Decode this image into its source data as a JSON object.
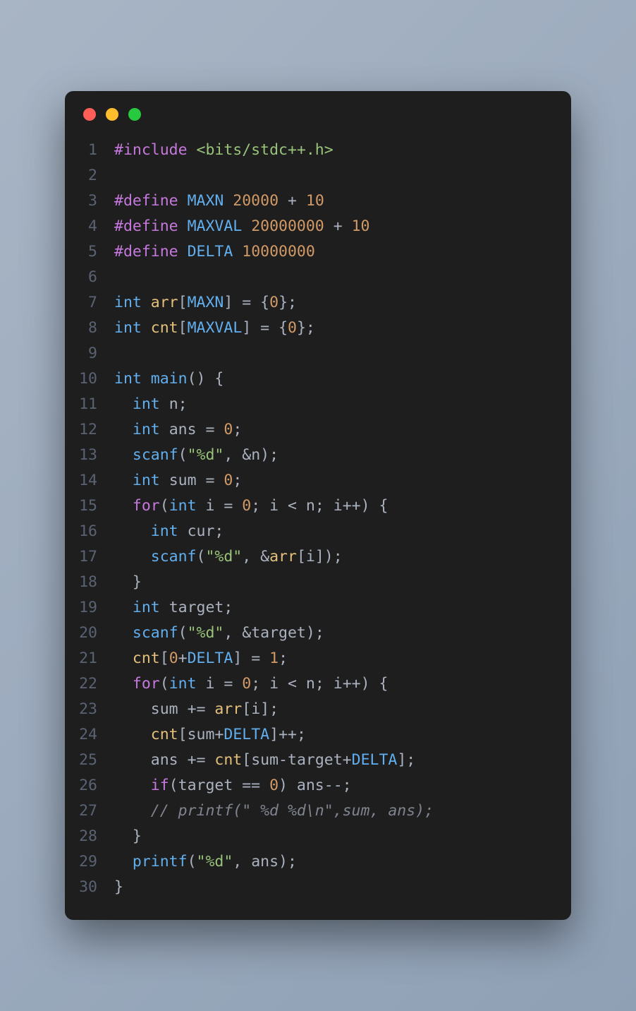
{
  "window": {
    "buttons": [
      "close",
      "minimize",
      "maximize"
    ]
  },
  "code": {
    "lines": [
      {
        "n": "1",
        "tokens": [
          [
            "directive",
            "#include"
          ],
          [
            "op",
            " "
          ],
          [
            "string",
            "<bits/stdc++.h>"
          ]
        ]
      },
      {
        "n": "2",
        "tokens": []
      },
      {
        "n": "3",
        "tokens": [
          [
            "directive",
            "#define"
          ],
          [
            "op",
            " "
          ],
          [
            "macro-name",
            "MAXN"
          ],
          [
            "op",
            " "
          ],
          [
            "number",
            "20000"
          ],
          [
            "op",
            " + "
          ],
          [
            "number",
            "10"
          ]
        ]
      },
      {
        "n": "4",
        "tokens": [
          [
            "directive",
            "#define"
          ],
          [
            "op",
            " "
          ],
          [
            "macro-name",
            "MAXVAL"
          ],
          [
            "op",
            " "
          ],
          [
            "number",
            "20000000"
          ],
          [
            "op",
            " + "
          ],
          [
            "number",
            "10"
          ]
        ]
      },
      {
        "n": "5",
        "tokens": [
          [
            "directive",
            "#define"
          ],
          [
            "op",
            " "
          ],
          [
            "macro-name",
            "DELTA"
          ],
          [
            "op",
            " "
          ],
          [
            "number",
            "10000000"
          ]
        ]
      },
      {
        "n": "6",
        "tokens": []
      },
      {
        "n": "7",
        "tokens": [
          [
            "type",
            "int"
          ],
          [
            "op",
            " "
          ],
          [
            "ident",
            "arr"
          ],
          [
            "punct",
            "["
          ],
          [
            "macro-name",
            "MAXN"
          ],
          [
            "punct",
            "]"
          ],
          [
            "op",
            " = "
          ],
          [
            "punct",
            "{"
          ],
          [
            "number",
            "0"
          ],
          [
            "punct",
            "};"
          ]
        ]
      },
      {
        "n": "8",
        "tokens": [
          [
            "type",
            "int"
          ],
          [
            "op",
            " "
          ],
          [
            "ident",
            "cnt"
          ],
          [
            "punct",
            "["
          ],
          [
            "macro-name",
            "MAXVAL"
          ],
          [
            "punct",
            "]"
          ],
          [
            "op",
            " = "
          ],
          [
            "punct",
            "{"
          ],
          [
            "number",
            "0"
          ],
          [
            "punct",
            "};"
          ]
        ]
      },
      {
        "n": "9",
        "tokens": []
      },
      {
        "n": "10",
        "tokens": [
          [
            "type",
            "int"
          ],
          [
            "op",
            " "
          ],
          [
            "func",
            "main"
          ],
          [
            "punct",
            "()"
          ],
          [
            "op",
            " "
          ],
          [
            "punct",
            "{"
          ]
        ]
      },
      {
        "n": "11",
        "tokens": [
          [
            "op",
            "  "
          ],
          [
            "type",
            "int"
          ],
          [
            "op",
            " "
          ],
          [
            "var",
            "n"
          ],
          [
            "punct",
            ";"
          ]
        ]
      },
      {
        "n": "12",
        "tokens": [
          [
            "op",
            "  "
          ],
          [
            "type",
            "int"
          ],
          [
            "op",
            " "
          ],
          [
            "var",
            "ans"
          ],
          [
            "op",
            " = "
          ],
          [
            "number",
            "0"
          ],
          [
            "punct",
            ";"
          ]
        ]
      },
      {
        "n": "13",
        "tokens": [
          [
            "op",
            "  "
          ],
          [
            "func",
            "scanf"
          ],
          [
            "punct",
            "("
          ],
          [
            "string",
            "\"%d\""
          ],
          [
            "punct",
            ", "
          ],
          [
            "op",
            "&"
          ],
          [
            "var",
            "n"
          ],
          [
            "punct",
            ");"
          ]
        ]
      },
      {
        "n": "14",
        "tokens": [
          [
            "op",
            "  "
          ],
          [
            "type",
            "int"
          ],
          [
            "op",
            " "
          ],
          [
            "var",
            "sum"
          ],
          [
            "op",
            " = "
          ],
          [
            "number",
            "0"
          ],
          [
            "punct",
            ";"
          ]
        ]
      },
      {
        "n": "15",
        "tokens": [
          [
            "op",
            "  "
          ],
          [
            "keyword",
            "for"
          ],
          [
            "punct",
            "("
          ],
          [
            "type",
            "int"
          ],
          [
            "op",
            " "
          ],
          [
            "var",
            "i"
          ],
          [
            "op",
            " = "
          ],
          [
            "number",
            "0"
          ],
          [
            "punct",
            "; "
          ],
          [
            "var",
            "i"
          ],
          [
            "op",
            " < "
          ],
          [
            "var",
            "n"
          ],
          [
            "punct",
            "; "
          ],
          [
            "var",
            "i"
          ],
          [
            "op",
            "++"
          ],
          [
            "punct",
            ") {"
          ]
        ]
      },
      {
        "n": "16",
        "tokens": [
          [
            "op",
            "    "
          ],
          [
            "type",
            "int"
          ],
          [
            "op",
            " "
          ],
          [
            "var",
            "cur"
          ],
          [
            "punct",
            ";"
          ]
        ]
      },
      {
        "n": "17",
        "tokens": [
          [
            "op",
            "    "
          ],
          [
            "func",
            "scanf"
          ],
          [
            "punct",
            "("
          ],
          [
            "string",
            "\"%d\""
          ],
          [
            "punct",
            ", "
          ],
          [
            "op",
            "&"
          ],
          [
            "ident",
            "arr"
          ],
          [
            "punct",
            "["
          ],
          [
            "var",
            "i"
          ],
          [
            "punct",
            "]);"
          ]
        ]
      },
      {
        "n": "18",
        "tokens": [
          [
            "op",
            "  "
          ],
          [
            "punct",
            "}"
          ]
        ]
      },
      {
        "n": "19",
        "tokens": [
          [
            "op",
            "  "
          ],
          [
            "type",
            "int"
          ],
          [
            "op",
            " "
          ],
          [
            "var",
            "target"
          ],
          [
            "punct",
            ";"
          ]
        ]
      },
      {
        "n": "20",
        "tokens": [
          [
            "op",
            "  "
          ],
          [
            "func",
            "scanf"
          ],
          [
            "punct",
            "("
          ],
          [
            "string",
            "\"%d\""
          ],
          [
            "punct",
            ", "
          ],
          [
            "op",
            "&"
          ],
          [
            "var",
            "target"
          ],
          [
            "punct",
            ");"
          ]
        ]
      },
      {
        "n": "21",
        "tokens": [
          [
            "op",
            "  "
          ],
          [
            "ident",
            "cnt"
          ],
          [
            "punct",
            "["
          ],
          [
            "number",
            "0"
          ],
          [
            "op",
            "+"
          ],
          [
            "macro-name",
            "DELTA"
          ],
          [
            "punct",
            "]"
          ],
          [
            "op",
            " = "
          ],
          [
            "number",
            "1"
          ],
          [
            "punct",
            ";"
          ]
        ]
      },
      {
        "n": "22",
        "tokens": [
          [
            "op",
            "  "
          ],
          [
            "keyword",
            "for"
          ],
          [
            "punct",
            "("
          ],
          [
            "type",
            "int"
          ],
          [
            "op",
            " "
          ],
          [
            "var",
            "i"
          ],
          [
            "op",
            " = "
          ],
          [
            "number",
            "0"
          ],
          [
            "punct",
            "; "
          ],
          [
            "var",
            "i"
          ],
          [
            "op",
            " < "
          ],
          [
            "var",
            "n"
          ],
          [
            "punct",
            "; "
          ],
          [
            "var",
            "i"
          ],
          [
            "op",
            "++"
          ],
          [
            "punct",
            ") {"
          ]
        ]
      },
      {
        "n": "23",
        "tokens": [
          [
            "op",
            "    "
          ],
          [
            "var",
            "sum"
          ],
          [
            "op",
            " += "
          ],
          [
            "ident",
            "arr"
          ],
          [
            "punct",
            "["
          ],
          [
            "var",
            "i"
          ],
          [
            "punct",
            "];"
          ]
        ]
      },
      {
        "n": "24",
        "tokens": [
          [
            "op",
            "    "
          ],
          [
            "ident",
            "cnt"
          ],
          [
            "punct",
            "["
          ],
          [
            "var",
            "sum"
          ],
          [
            "op",
            "+"
          ],
          [
            "macro-name",
            "DELTA"
          ],
          [
            "punct",
            "]"
          ],
          [
            "op",
            "++"
          ],
          [
            "punct",
            ";"
          ]
        ]
      },
      {
        "n": "25",
        "tokens": [
          [
            "op",
            "    "
          ],
          [
            "var",
            "ans"
          ],
          [
            "op",
            " += "
          ],
          [
            "ident",
            "cnt"
          ],
          [
            "punct",
            "["
          ],
          [
            "var",
            "sum"
          ],
          [
            "op",
            "-"
          ],
          [
            "var",
            "target"
          ],
          [
            "op",
            "+"
          ],
          [
            "macro-name",
            "DELTA"
          ],
          [
            "punct",
            "];"
          ]
        ]
      },
      {
        "n": "26",
        "tokens": [
          [
            "op",
            "    "
          ],
          [
            "keyword",
            "if"
          ],
          [
            "punct",
            "("
          ],
          [
            "var",
            "target"
          ],
          [
            "op",
            " == "
          ],
          [
            "number",
            "0"
          ],
          [
            "punct",
            ") "
          ],
          [
            "var",
            "ans"
          ],
          [
            "op",
            "--"
          ],
          [
            "punct",
            ";"
          ]
        ]
      },
      {
        "n": "27",
        "tokens": [
          [
            "op",
            "    "
          ],
          [
            "comment",
            "// printf(\" %d %d\\n\",sum, ans);"
          ]
        ]
      },
      {
        "n": "28",
        "tokens": [
          [
            "op",
            "  "
          ],
          [
            "punct",
            "}"
          ]
        ]
      },
      {
        "n": "29",
        "tokens": [
          [
            "op",
            "  "
          ],
          [
            "func",
            "printf"
          ],
          [
            "punct",
            "("
          ],
          [
            "string",
            "\"%d\""
          ],
          [
            "punct",
            ", "
          ],
          [
            "var",
            "ans"
          ],
          [
            "punct",
            ");"
          ]
        ]
      },
      {
        "n": "30",
        "tokens": [
          [
            "punct",
            "}"
          ]
        ]
      }
    ]
  }
}
